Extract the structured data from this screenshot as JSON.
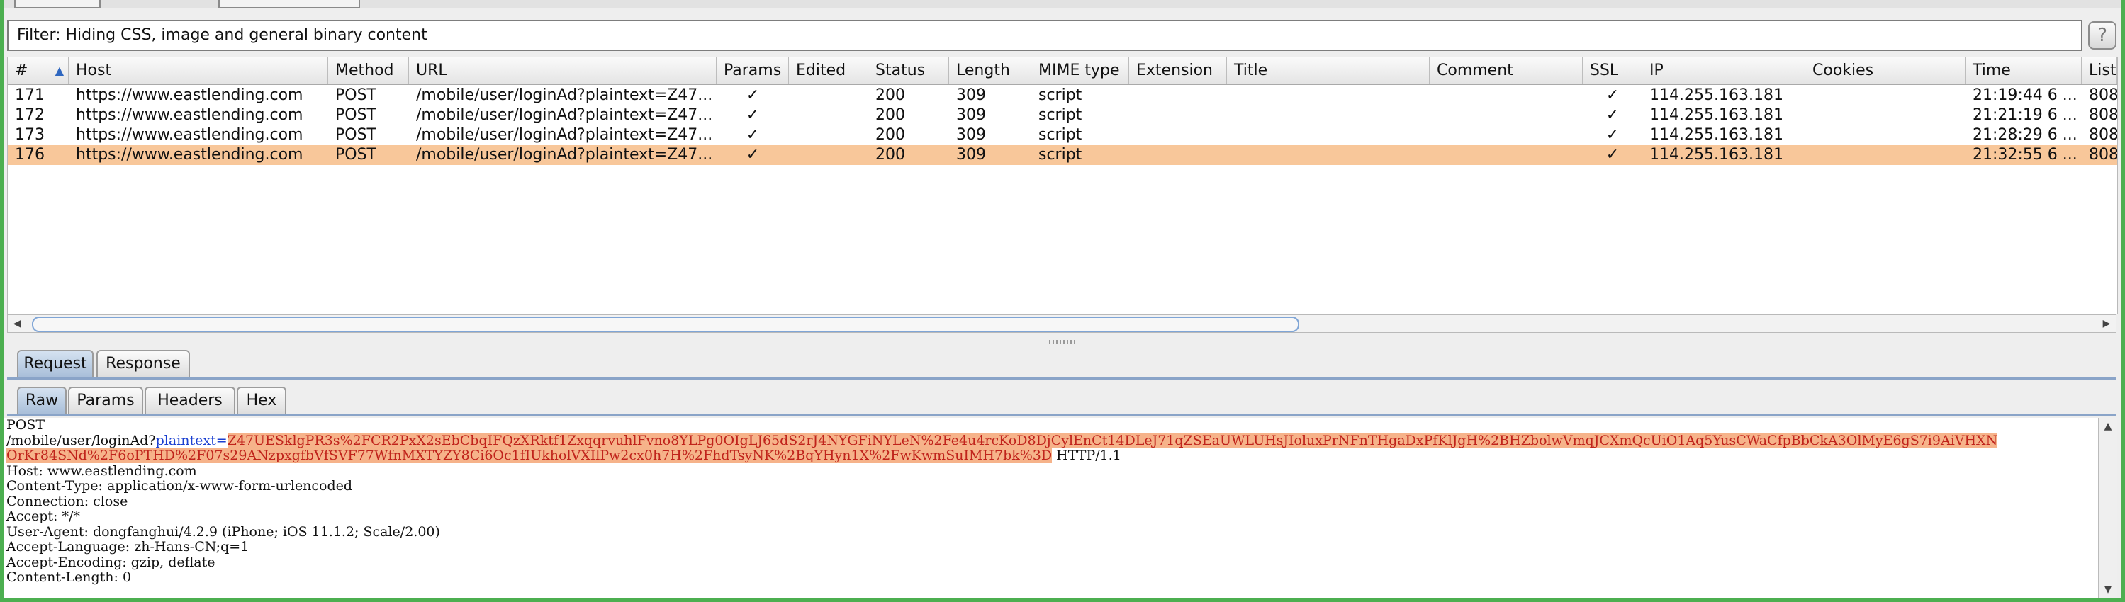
{
  "filter": {
    "text": "Filter: Hiding CSS, image and general binary content",
    "help": "?"
  },
  "table": {
    "headers": [
      "#",
      "Host",
      "Method",
      "URL",
      "Params",
      "Edited",
      "Status",
      "Length",
      "MIME type",
      "Extension",
      "Title",
      "Comment",
      "SSL",
      "IP",
      "Cookies",
      "Time",
      "List"
    ],
    "rows": [
      [
        "171",
        "https://www.eastlending.com",
        "POST",
        "/mobile/user/loginAd?plaintext=Z47...",
        "✓",
        "",
        "200",
        "309",
        "script",
        "",
        "",
        "",
        "✓",
        "114.255.163.181",
        "",
        "21:19:44 6 ...",
        "808"
      ],
      [
        "172",
        "https://www.eastlending.com",
        "POST",
        "/mobile/user/loginAd?plaintext=Z47...",
        "✓",
        "",
        "200",
        "309",
        "script",
        "",
        "",
        "",
        "✓",
        "114.255.163.181",
        "",
        "21:21:19 6 ...",
        "808"
      ],
      [
        "173",
        "https://www.eastlending.com",
        "POST",
        "/mobile/user/loginAd?plaintext=Z47...",
        "✓",
        "",
        "200",
        "309",
        "script",
        "",
        "",
        "",
        "✓",
        "114.255.163.181",
        "",
        "21:28:29 6 ...",
        "808"
      ],
      [
        "176",
        "https://www.eastlending.com",
        "POST",
        "/mobile/user/loginAd?plaintext=Z47...",
        "✓",
        "",
        "200",
        "309",
        "script",
        "",
        "",
        "",
        "✓",
        "114.255.163.181",
        "",
        "21:32:55 6 ...",
        "808"
      ]
    ]
  },
  "message_tabs": [
    "Request",
    "Response"
  ],
  "view_tabs": [
    "Raw",
    "Params",
    "Headers",
    "Hex"
  ],
  "raw": {
    "method": "POST",
    "path": "/mobile/user/loginAd?",
    "param_name": "plaintext",
    "eq": "=",
    "param_value_1": "Z47UESklgPR3s%2FCR2PxX2sEbCbqIFQzXRktf1ZxqqrvuhlFvno8YLPg0OIgLJ65dS2rJ4NYGFiNYLeN%2Fe4u4rcKoD8DjCylEnCt14DLeJ71qZSEaUWLUHsJIoluxPrNFnTHgaDxPfKlJgH%2BHZbolwVmqJCXmQcUiO1Aq5YusCWaCfpBbCkA3OlMyE6gS7i9AiVHXN",
    "param_value_2": "OrKr84SNd%2F6oPTHD%2F07s29ANzpxgfbVfSVF77WfnMXTYZY8Ci6Oc1fIUkholVXIlPw2cx0h7H%2FhdTsyNK%2BqYHyn1X%2FwKwmSuIMH7bk%3D",
    "protocol": " HTTP/1.1",
    "headers": [
      "Host: www.eastlending.com",
      "Content-Type: application/x-www-form-urlencoded",
      "Connection: close",
      "Accept: */*",
      "User-Agent: dongfanghui/4.2.9 (iPhone; iOS 11.1.2; Scale/2.00)",
      "Accept-Language: zh-Hans-CN;q=1",
      "Accept-Encoding: gzip, deflate",
      "Content-Length: 0"
    ]
  },
  "icons": {
    "sort": "sort-ascending-icon",
    "scroll_left": "arrow-left-icon",
    "scroll_right": "arrow-right-icon",
    "scroll_up": "arrow-up-icon",
    "scroll_down": "arrow-down-icon"
  },
  "colors": {
    "window_border": "#4caf50",
    "selected_row": "#f8c79a",
    "highlight": "#f6b38a",
    "highlight_text": "#c0231b",
    "param_name": "#1a3fd0",
    "active_tab": "#a9bfd9"
  }
}
